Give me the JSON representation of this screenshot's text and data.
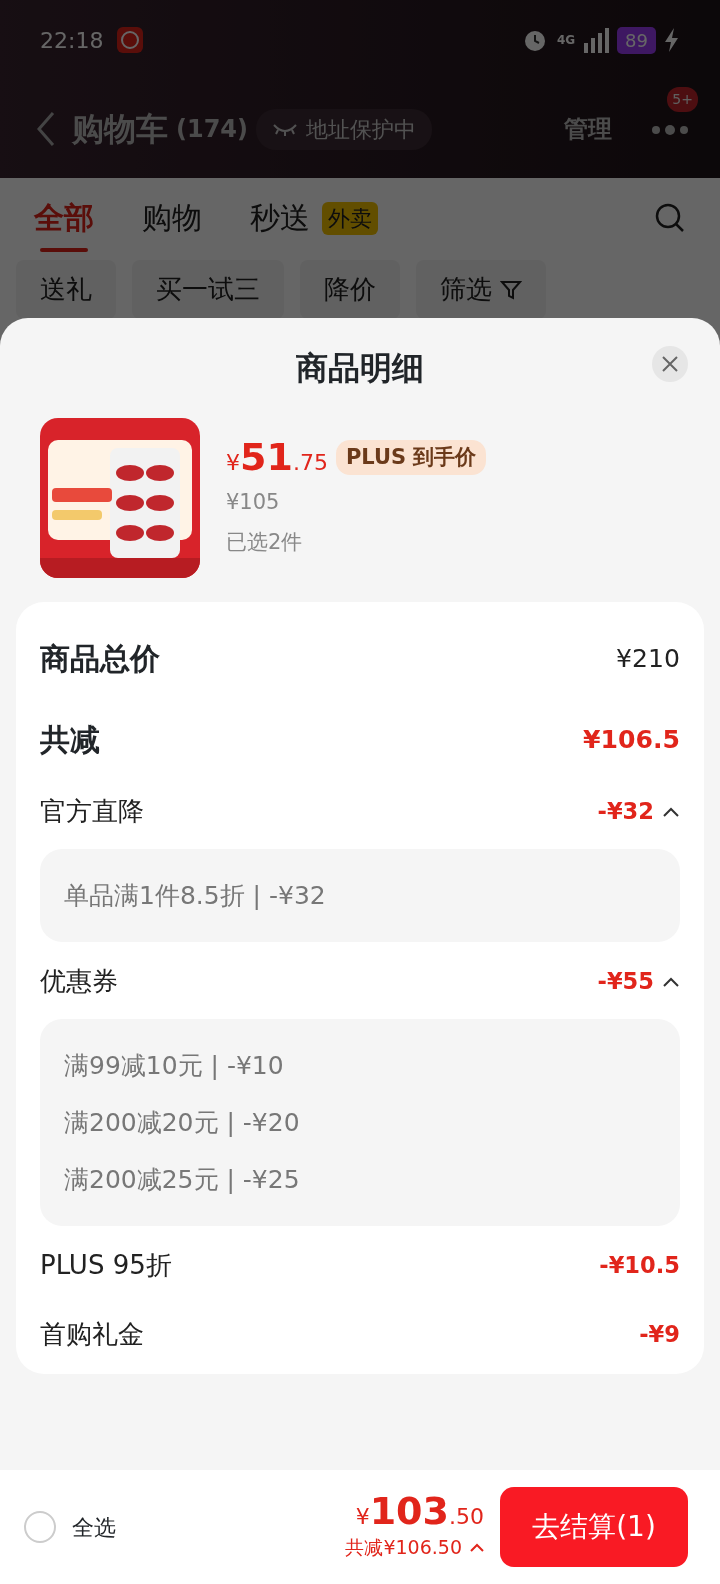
{
  "status_bar": {
    "time": "22:18",
    "network": "4G",
    "battery": "89"
  },
  "header": {
    "title": "购物车",
    "count": "(174)",
    "address_chip": "地址保护中",
    "manage": "管理",
    "more_badge": "5+"
  },
  "tabs": [
    {
      "label": "全部",
      "selected": true
    },
    {
      "label": "购物",
      "selected": false
    },
    {
      "label": "秒送",
      "badge": "外卖",
      "selected": false
    }
  ],
  "filters": [
    "送礼",
    "买一试三",
    "降价",
    "筛选"
  ],
  "sheet": {
    "title": "商品明细",
    "product": {
      "currency": "¥",
      "price_int": "51",
      "price_dec": ".75",
      "tag": "PLUS 到手价",
      "original_price": "¥105",
      "selected_count": "已选2件"
    },
    "total": {
      "label": "商品总价",
      "value": "¥210"
    },
    "reduction": {
      "label": "共减",
      "value": "¥106.5"
    },
    "discounts": [
      {
        "label": "官方直降",
        "value": "-¥32",
        "expanded": true,
        "details": [
          "单品满1件8.5折 | -¥32"
        ]
      },
      {
        "label": "优惠券",
        "value": "-¥55",
        "expanded": true,
        "details": [
          "满99减10元 | -¥10",
          "满200减20元 | -¥20",
          "满200减25元 | -¥25"
        ]
      },
      {
        "label": "PLUS 95折",
        "value": "-¥10.5"
      },
      {
        "label": "首购礼金",
        "value": "-¥9"
      }
    ]
  },
  "bottom_bar": {
    "select_all": {
      "label": "全选",
      "checked": false
    },
    "currency": "¥",
    "total_int": "103",
    "total_dec": ".50",
    "saved": "共减¥106.50",
    "saved_expanded": true,
    "checkout": "去结算(1)"
  }
}
